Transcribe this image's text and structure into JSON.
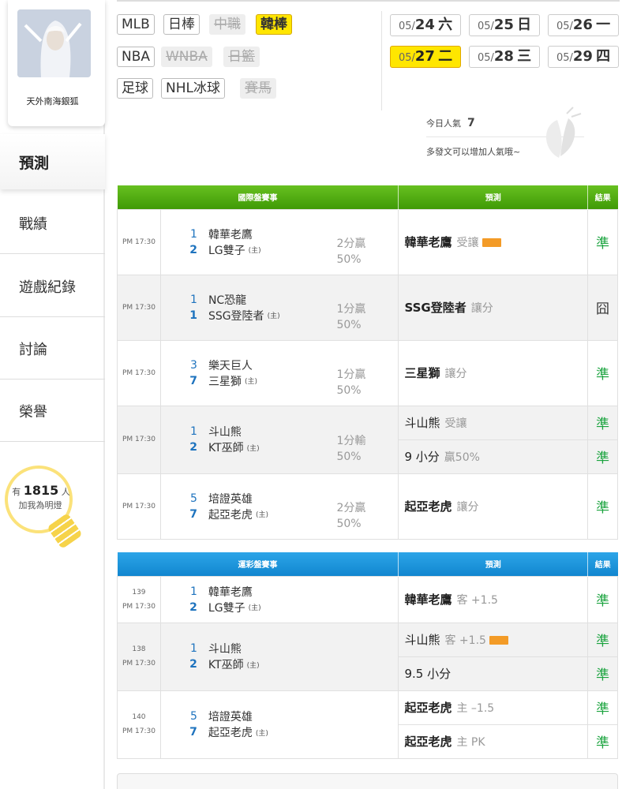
{
  "user": {
    "name": "天外南海銀狐",
    "fans_prefix": "有",
    "fans_count": "1815",
    "fans_suffix": "人",
    "fans_cta": "加我為明燈"
  },
  "sidebar": {
    "active": "預測",
    "items": [
      "戰績",
      "遊戲紀錄",
      "討論",
      "榮譽"
    ]
  },
  "leagues": [
    {
      "label": "MLB",
      "state": "normal"
    },
    {
      "label": "日棒",
      "state": "normal"
    },
    {
      "label": "中職",
      "state": "disabled"
    },
    {
      "label": "韓棒",
      "state": "selected"
    },
    {
      "label": "NBA",
      "state": "normal"
    },
    {
      "label": "WNBA",
      "state": "disabled"
    },
    {
      "label": "日籃",
      "state": "disabled"
    },
    {
      "label": "足球",
      "state": "normal"
    },
    {
      "label": "NHL冰球",
      "state": "normal"
    },
    {
      "label": "賽馬",
      "state": "disabled"
    }
  ],
  "dates": [
    {
      "md": "05/",
      "day": "24",
      "dow": "六",
      "selected": false
    },
    {
      "md": "05/",
      "day": "25",
      "dow": "日",
      "selected": false
    },
    {
      "md": "05/",
      "day": "26",
      "dow": "一",
      "selected": false
    },
    {
      "md": "05/",
      "day": "27",
      "dow": "二",
      "selected": true
    },
    {
      "md": "05/",
      "day": "28",
      "dow": "三",
      "selected": false
    },
    {
      "md": "05/",
      "day": "29",
      "dow": "四",
      "selected": false
    }
  ],
  "popularity": {
    "label": "今日人氣",
    "value": "7",
    "hint": "多發文可以增加人氣哦~"
  },
  "intl": {
    "headers": [
      "國際盤賽事",
      "預測",
      "結果"
    ],
    "rows": [
      {
        "time": "PM 17:30",
        "away": {
          "score": "1",
          "team": "韓華老鷹"
        },
        "home": {
          "score": "2",
          "team": "LG雙子"
        },
        "host": "(主)",
        "odds": [
          "2分贏",
          "50%"
        ],
        "preds": [
          {
            "team": "韓華老鷹",
            "sub": "受讓",
            "badge": true,
            "result": "準"
          }
        ]
      },
      {
        "time": "PM 17:30",
        "away": {
          "score": "1",
          "team": "NC恐龍"
        },
        "home": {
          "score": "1",
          "team": "SSG登陸者"
        },
        "host": "(主)",
        "odds": [
          "1分贏",
          "50%"
        ],
        "preds": [
          {
            "team": "SSG登陸者",
            "sub": "讓分",
            "badge": false,
            "result": "囧"
          }
        ]
      },
      {
        "time": "PM 17:30",
        "away": {
          "score": "3",
          "team": "樂天巨人"
        },
        "home": {
          "score": "7",
          "team": "三星獅"
        },
        "host": "(主)",
        "odds": [
          "1分贏",
          "50%"
        ],
        "preds": [
          {
            "team": "三星獅",
            "sub": "讓分",
            "badge": false,
            "result": "準"
          }
        ]
      },
      {
        "time": "PM 17:30",
        "away": {
          "score": "1",
          "team": "斗山熊"
        },
        "home": {
          "score": "2",
          "team": "KT巫師"
        },
        "host": "(主)",
        "odds": [
          "1分輸",
          "50%"
        ],
        "preds": [
          {
            "team": "斗山熊",
            "sub": "受讓",
            "badge": false,
            "result": "準"
          },
          {
            "team": "9 小分",
            "sub": "贏50%",
            "badge": false,
            "result": "準"
          }
        ]
      },
      {
        "time": "PM 17:30",
        "away": {
          "score": "5",
          "team": "培證英雄"
        },
        "home": {
          "score": "7",
          "team": "起亞老虎"
        },
        "host": "(主)",
        "odds": [
          "2分贏",
          "50%"
        ],
        "preds": [
          {
            "team": "起亞老虎",
            "sub": "讓分",
            "badge": false,
            "result": "準"
          }
        ]
      }
    ]
  },
  "lottery": {
    "headers": [
      "運彩盤賽事",
      "預測",
      "結果"
    ],
    "rows": [
      {
        "no": "139",
        "time": "PM 17:30",
        "away": {
          "score": "1",
          "team": "韓華老鷹"
        },
        "home": {
          "score": "2",
          "team": "LG雙子"
        },
        "host": "(主)",
        "preds": [
          {
            "team": "韓華老鷹",
            "sub": "客 +1.5",
            "badge": false,
            "result": "準"
          }
        ]
      },
      {
        "no": "138",
        "time": "PM 17:30",
        "away": {
          "score": "1",
          "team": "斗山熊"
        },
        "home": {
          "score": "2",
          "team": "KT巫師"
        },
        "host": "(主)",
        "preds": [
          {
            "team": "斗山熊",
            "sub": "客 +1.5",
            "badge": true,
            "result": "準"
          },
          {
            "team": "9.5 小分",
            "sub": "",
            "badge": false,
            "result": "準"
          }
        ]
      },
      {
        "no": "140",
        "time": "PM 17:30",
        "away": {
          "score": "5",
          "team": "培證英雄"
        },
        "home": {
          "score": "7",
          "team": "起亞老虎"
        },
        "host": "(主)",
        "preds": [
          {
            "team": "起亞老虎",
            "sub": "主 –1.5",
            "badge": false,
            "result": "準"
          },
          {
            "team": "起亞老虎",
            "sub": "主 PK",
            "badge": false,
            "result": "準"
          }
        ]
      }
    ]
  },
  "colors": {
    "accent_yellow": "#ffe600",
    "green_header": "#4aa60d",
    "blue_header": "#1a95dc",
    "result_green": "#1aa33e",
    "score_blue": "#1e73be",
    "badge_orange": "#f39b27"
  }
}
